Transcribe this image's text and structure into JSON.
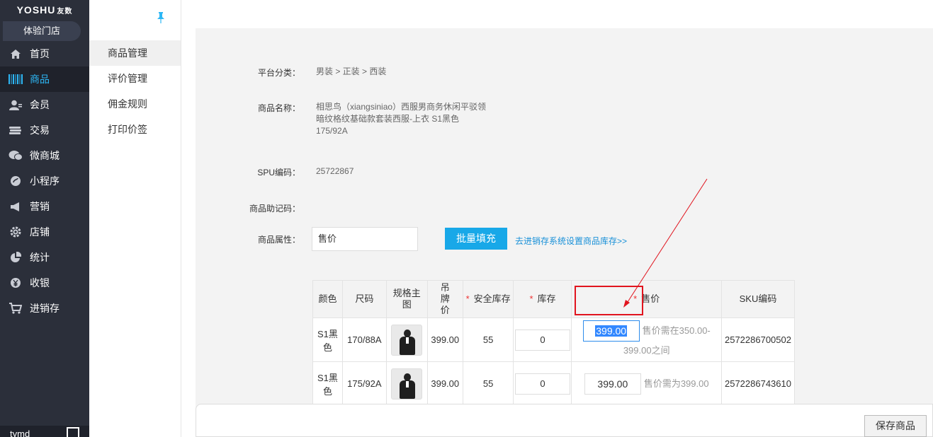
{
  "brand": {
    "name": "YOSHU",
    "sub": "友数"
  },
  "store": "体验门店",
  "nav": [
    {
      "label": "首页",
      "icon": "home-icon"
    },
    {
      "label": "商品",
      "icon": "barcode-icon",
      "active": true
    },
    {
      "label": "会员",
      "icon": "member-icon"
    },
    {
      "label": "交易",
      "icon": "coins-icon"
    },
    {
      "label": "微商城",
      "icon": "wechat-icon"
    },
    {
      "label": "小程序",
      "icon": "miniapp-icon"
    },
    {
      "label": "营销",
      "icon": "megaphone-icon"
    },
    {
      "label": "店铺",
      "icon": "gear-icon"
    },
    {
      "label": "统计",
      "icon": "pie-icon"
    },
    {
      "label": "收银",
      "icon": "yuan-icon"
    },
    {
      "label": "进销存",
      "icon": "cart-icon"
    }
  ],
  "user": "tymd",
  "submenu": [
    {
      "label": "商品管理",
      "active": true
    },
    {
      "label": "评价管理"
    },
    {
      "label": "佣金规则"
    },
    {
      "label": "打印价签"
    }
  ],
  "form": {
    "category_label": "平台分类：",
    "category_value": "男装 > 正装 > 西装",
    "name_label": "商品名称：",
    "name_lines": [
      "相思鸟（xiangsiniao）西服男商务休闲平驳领",
      "暗纹格纹基础款套装西服-上衣 S1黑色",
      "175/92A"
    ],
    "spu_label": "SPU编码：",
    "spu_value": "25722867",
    "mnemonic_label": "商品助记码：",
    "attr_label": "商品属性：",
    "attr_value": "售价",
    "batch_button": "批量填充",
    "stock_link": "去进销存系统设置商品库存>>"
  },
  "table": {
    "headers": {
      "color": "颜色",
      "size": "尺码",
      "image": "规格主图",
      "tag_price": "吊牌价",
      "safe_stock": "安全库存",
      "stock": "库存",
      "price": "售价",
      "sku": "SKU编码"
    },
    "rows": [
      {
        "color": "S1黑色",
        "size": "170/88A",
        "tag_price": "399.00",
        "safe_stock": "55",
        "stock": "0",
        "price": "399.00",
        "hint_a": "售价需在350.00-",
        "hint_b": "399.00之间",
        "sku": "2572286700502"
      },
      {
        "color": "S1黑色",
        "size": "175/92A",
        "tag_price": "399.00",
        "safe_stock": "55",
        "stock": "0",
        "price": "399.00",
        "hint_a": "售价需为399.00",
        "hint_b": "",
        "sku": "2572286743610"
      }
    ]
  },
  "save_button": "保存商品",
  "colors": {
    "sidebar": "#2b2f3a",
    "accent": "#18a8e8",
    "highlight": "#e1141e"
  }
}
